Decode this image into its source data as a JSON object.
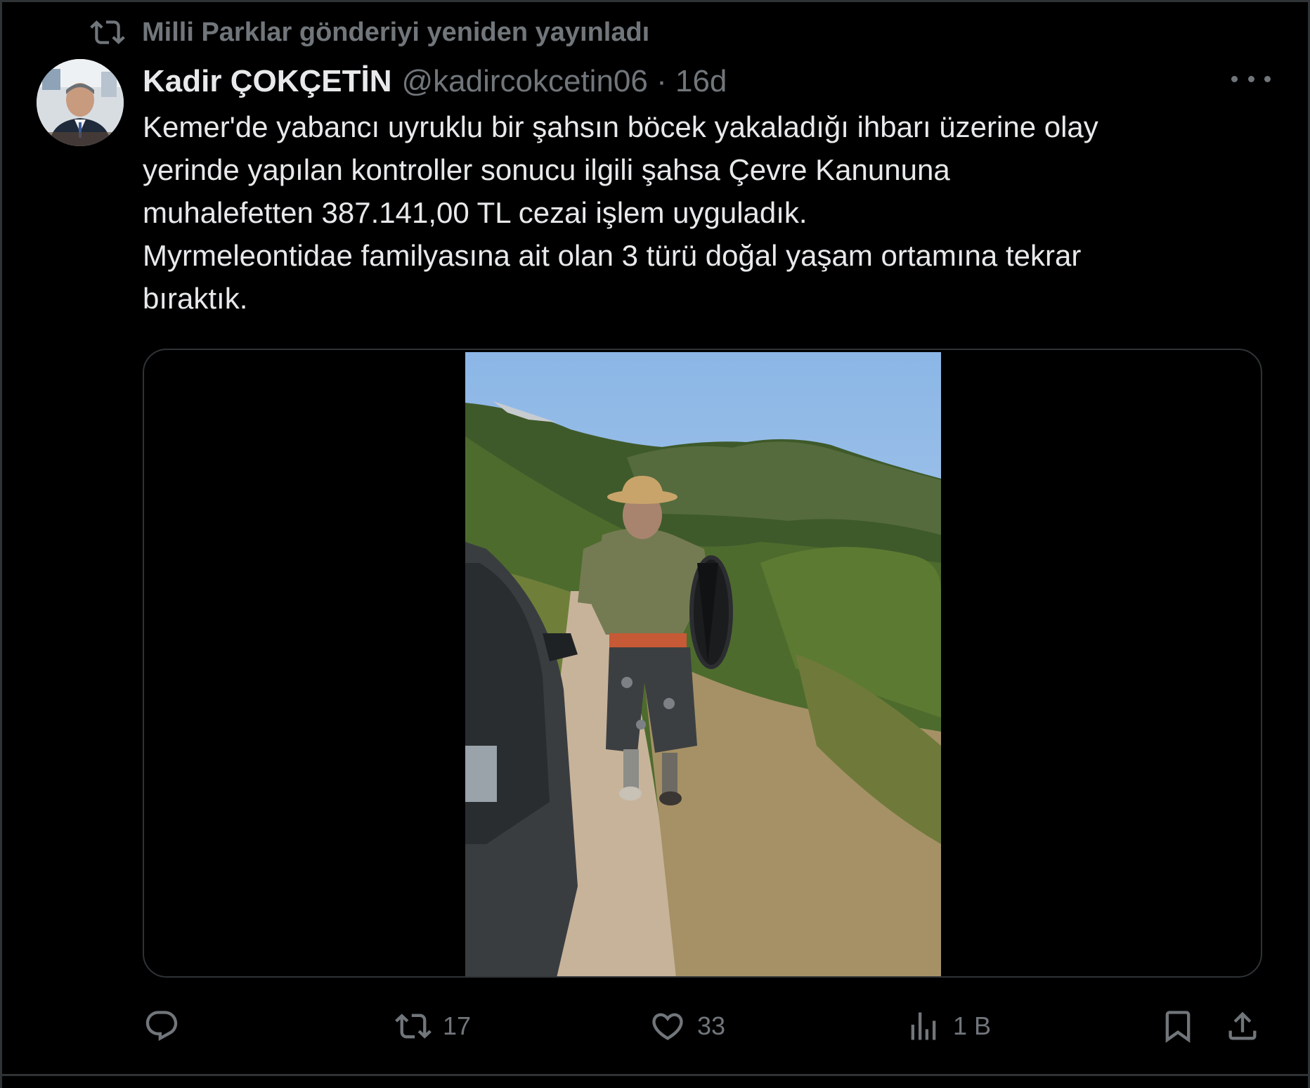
{
  "repost": {
    "text": "Milli Parklar gönderiyi yeniden yayınladı",
    "icon": "repost-icon"
  },
  "author": {
    "name": "Kadir ÇOKÇETİN",
    "handle_time": "@kadircokcetin06 · 16d"
  },
  "tweet": {
    "lines": [
      "Kemer'de yabancı uyruklu bir şahsın böcek yakaladığı ihbarı üzerine olay",
      "yerinde yapılan kontroller sonucu ilgili şahsa  Çevre Kanununa",
      "muhalefetten  387.141,00 TL cezai işlem uyguladık.",
      "Myrmeleontidae familyasına ait olan 3 türü doğal yaşam ortamına tekrar",
      "bıraktık."
    ]
  },
  "actions": {
    "reply": {
      "icon": "reply-icon",
      "count": ""
    },
    "retweet": {
      "icon": "retweet-icon",
      "count": "17"
    },
    "like": {
      "icon": "heart-icon",
      "count": "33"
    },
    "views": {
      "icon": "views-icon",
      "count": "1 B"
    },
    "bookmark": {
      "icon": "bookmark-icon"
    },
    "share": {
      "icon": "share-icon"
    }
  },
  "colors": {
    "background": "#000000",
    "text": "#e7e9ea",
    "muted": "#71767b",
    "border": "#2f3336"
  }
}
